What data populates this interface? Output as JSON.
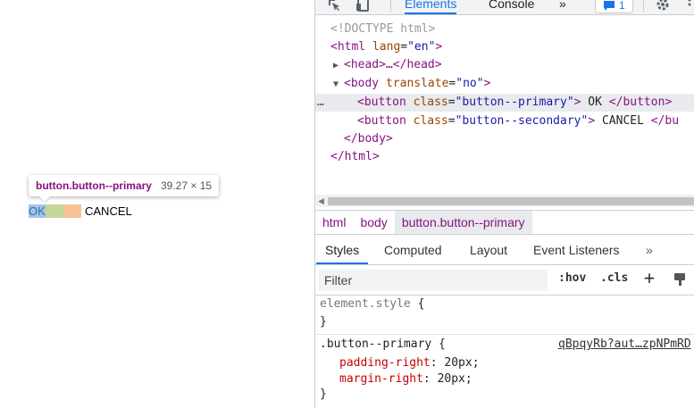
{
  "page": {
    "tooltip": {
      "selector": "button.button--primary",
      "size": "39.27 × 15"
    },
    "ok_label": "OK",
    "cancel_label": "CANCEL",
    "colors": {
      "content": "#9fc4e7",
      "padding": "#c3d89a",
      "margin": "#f6c494"
    }
  },
  "devtools": {
    "toolbar": {
      "tabs": [
        "Elements",
        "Console"
      ],
      "more": "»",
      "issues_count": "1",
      "icons": [
        "inspect-icon",
        "device-toggle-icon",
        "issues-icon",
        "gear-icon",
        "more-icon"
      ]
    },
    "tree": {
      "doctype": "<!DOCTYPE html>",
      "html_open_tag": "<html",
      "html_attr": "lang",
      "html_val": "\"en\"",
      "html_close_bracket": ">",
      "head": "<head>…</head>",
      "body_open_tag": "<body",
      "body_attr": "translate",
      "body_val": "\"no\"",
      "body_close_bracket": ">",
      "ellipsis": "…",
      "btn1_tag": "<button",
      "btn1_attr": "class",
      "btn1_val": "\"button--primary\"",
      "btn1_gt": ">",
      "btn1_text": " OK ",
      "btn1_close": "</button>",
      "btn2_tag": "<button",
      "btn2_attr": "class",
      "btn2_val": "\"button--secondary\"",
      "btn2_gt": ">",
      "btn2_text": " CANCEL ",
      "btn2_close": "</bu",
      "body_close": "</body>",
      "html_close": "</html>"
    },
    "breadcrumb": [
      "html",
      "body",
      "button.button--primary"
    ],
    "style_tabs": [
      "Styles",
      "Computed",
      "Layout",
      "Event Listeners"
    ],
    "style_tabs_more": "»",
    "filter": {
      "placeholder": "Filter",
      "hov": ":hov",
      "cls": ".cls",
      "add": "+"
    },
    "rules": {
      "element_style": {
        "selector": "element.style",
        "open": " {",
        "close": "}"
      },
      "primary": {
        "selector": ".button--primary",
        "open": " {",
        "source": "qBpqyRb?aut…zpNPmRD",
        "props": [
          {
            "name": "padding-right",
            "value": "20px"
          },
          {
            "name": "margin-right",
            "value": "20px"
          }
        ],
        "close": "}"
      }
    }
  }
}
